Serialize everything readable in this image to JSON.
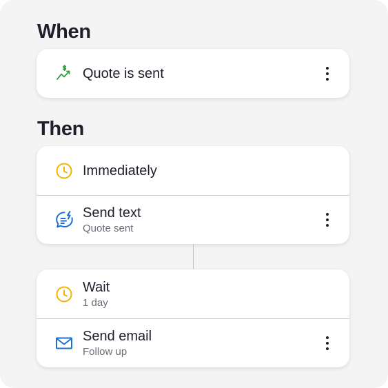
{
  "when": {
    "title": "When",
    "trigger": {
      "icon": "dollar-trend-icon",
      "label": "Quote is sent"
    }
  },
  "then": {
    "title": "Then",
    "steps": [
      {
        "timing": {
          "icon": "clock-icon",
          "label": "Immediately",
          "sub": ""
        },
        "action": {
          "icon": "text-message-icon",
          "label": "Send text",
          "sub": "Quote sent"
        }
      },
      {
        "timing": {
          "icon": "clock-icon",
          "label": "Wait",
          "sub": "1 day"
        },
        "action": {
          "icon": "email-icon",
          "label": "Send email",
          "sub": "Follow up"
        }
      }
    ]
  },
  "colors": {
    "clock": "#f0b400",
    "trend": "#2e9e44",
    "action_blue": "#1a6fd4",
    "panel_bg": "#f4f4f5"
  }
}
